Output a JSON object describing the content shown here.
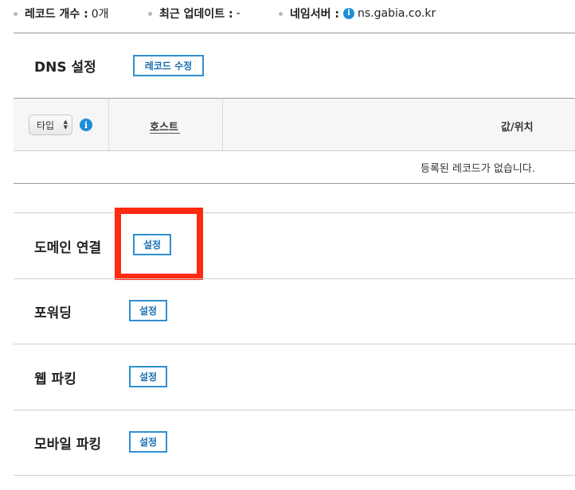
{
  "summary": {
    "record_count_label": "레코드 개수 :",
    "record_count_value": "0개",
    "last_update_label": "최근 업데이트 :",
    "last_update_value": "-",
    "nameserver_label": "네임서버 :",
    "nameserver_value": "ns.gabia.co.kr",
    "info_icon_glyph": "i"
  },
  "dns": {
    "title": "DNS 설정",
    "edit_button": "레코드 수정",
    "table": {
      "type_select_value": "타입",
      "columns": [
        "호스트",
        "값/위치"
      ],
      "empty_message": "등록된 레코드가 없습니다."
    }
  },
  "settings": [
    {
      "title": "도메인 연결",
      "button": "설정"
    },
    {
      "title": "포워딩",
      "button": "설정"
    },
    {
      "title": "웹 파킹",
      "button": "설정"
    },
    {
      "title": "모바일 파킹",
      "button": "설정"
    }
  ],
  "colors": {
    "accent": "#2f8fd0",
    "info_icon": "#1e8ed8",
    "highlight": "#ff2a10"
  }
}
